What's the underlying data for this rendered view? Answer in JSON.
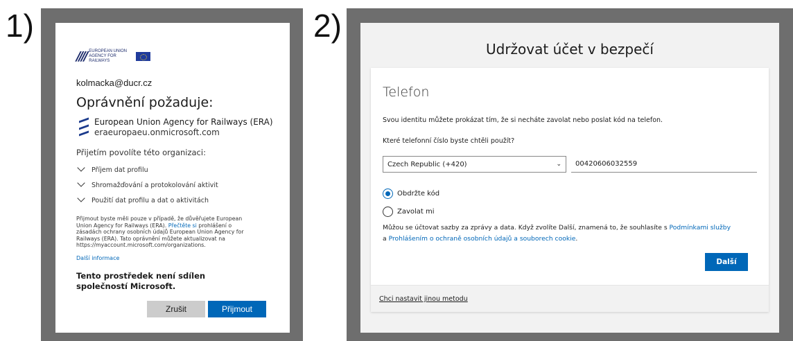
{
  "labels": {
    "step1": "1)",
    "step2": "2)"
  },
  "consent": {
    "logo_slashes": "////",
    "logo_text": "European Union Agency for Railways",
    "email": "kolmacka@ducr.cz",
    "title": "Oprávnění požaduje:",
    "org_name": "European Union Agency for Railways (ERA)",
    "org_domain": "eraeuropaeu.onmicrosoft.com",
    "allow_label": "Přijetím povolíte této organizaci:",
    "permissions": [
      "Příjem dat profilu",
      "Shromažďování a protokolování aktivit",
      "Použití dat profilu a dat o aktivitách"
    ],
    "notice_part1": "Přijmout byste měli pouze v případě, že důvěřujete European Union Agency for Railways (ERA). ",
    "notice_link": "Přečtěte si",
    "notice_part2": " prohlášení o zásadách ochrany osobních údajů European Union Agency for Railways (ERA). Tato oprávnění můžete aktualizovat na https://myaccount.microsoft.com/organizations.",
    "more_info": "Další informace",
    "not_shared": "Tento prostředek není sdílen společností Microsoft.",
    "cancel_label": "Zrušit",
    "accept_label": "Přijmout",
    "accent_color": "#0067b8"
  },
  "security": {
    "page_title": "Udržovat účet v bezpečí",
    "heading": "Telefon",
    "description": "Svou identitu můžete prokázat tím, že si necháte zavolat nebo poslat kód na telefon.",
    "question": "Které telefonní číslo byste chtěli použít?",
    "country_selected": "Czech Republic (+420)",
    "phone_value": "00420606032559",
    "options": [
      {
        "label": "Obdržte kód",
        "selected": true
      },
      {
        "label": "Zavolat mi",
        "selected": false
      }
    ],
    "rates_text": "Můžou se účtovat sazby za zprávy a data. Když zvolíte Další, znamená to, že souhlasíte s ",
    "terms_link": "Podmínkami služby",
    "and_text": " a ",
    "privacy_link": "Prohlášením o ochraně osobních údajů a souborech cookie",
    "period": ".",
    "next_label": "Další",
    "alt_method": "Chci nastavit jinou metodu"
  }
}
